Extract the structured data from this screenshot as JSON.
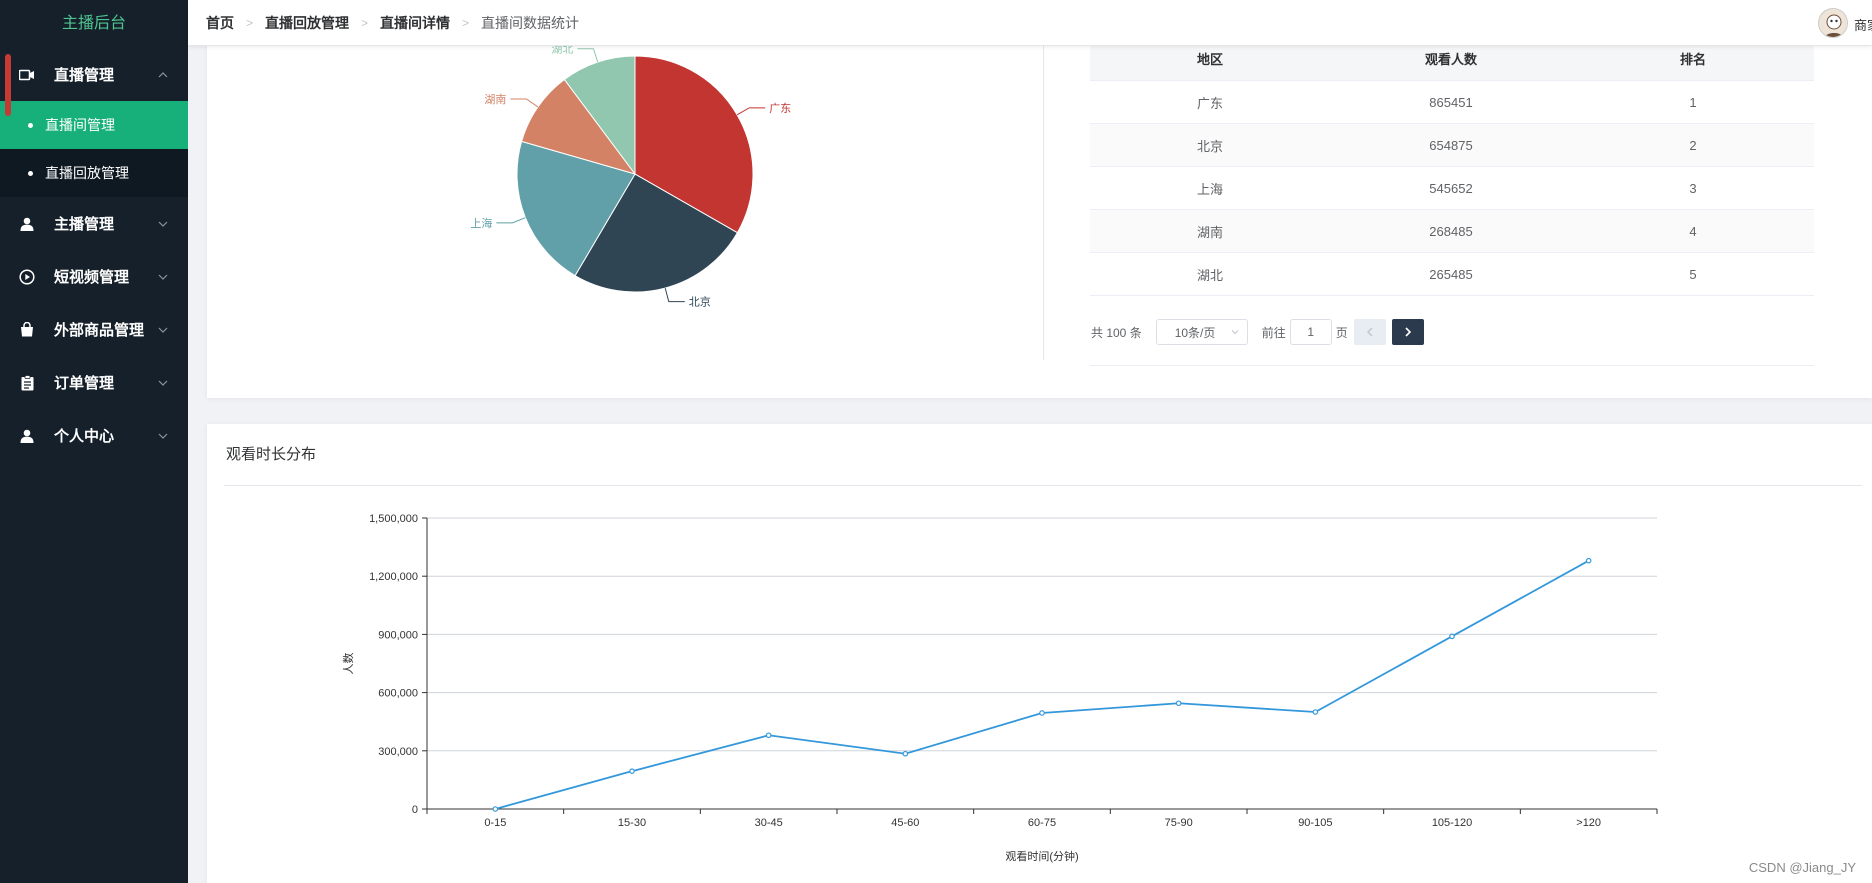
{
  "sidebar": {
    "brand": "主播后台",
    "menu": [
      {
        "label": "直播管理",
        "icon": "video-camera-icon",
        "expanded": true,
        "children": [
          {
            "label": "直播间管理",
            "active": true
          },
          {
            "label": "直播回放管理",
            "active": false
          }
        ]
      },
      {
        "label": "主播管理",
        "icon": "user-icon"
      },
      {
        "label": "短视频管理",
        "icon": "play-circle-icon"
      },
      {
        "label": "外部商品管理",
        "icon": "shopping-bag-icon"
      },
      {
        "label": "订单管理",
        "icon": "clipboard-icon"
      },
      {
        "label": "个人中心",
        "icon": "person-icon"
      }
    ]
  },
  "header": {
    "breadcrumb": [
      "首页",
      "直播回放管理",
      "直播间详情",
      "直播间数据统计"
    ],
    "user_name": "商家"
  },
  "region_table": {
    "columns": [
      "地区",
      "观看人数",
      "排名"
    ],
    "rows": [
      [
        "广东",
        "865451",
        "1"
      ],
      [
        "北京",
        "654875",
        "2"
      ],
      [
        "上海",
        "545652",
        "3"
      ],
      [
        "湖南",
        "268485",
        "4"
      ],
      [
        "湖北",
        "265485",
        "5"
      ]
    ]
  },
  "pagination": {
    "total": "共 100 条",
    "page_size": "10条/页",
    "goto_label": "前往",
    "page_value": "1",
    "page_suffix": "页"
  },
  "duration_card": {
    "title": "观看时长分布"
  },
  "watermark": "CSDN @Jiang_JY",
  "chart_data": [
    {
      "type": "pie",
      "labels": [
        "广东",
        "北京",
        "上海",
        "湖南",
        "湖北"
      ],
      "values": [
        865451,
        654875,
        545652,
        268485,
        265485
      ],
      "colors": [
        "#c23531",
        "#2f4554",
        "#61a0a8",
        "#d48265",
        "#91c7ae"
      ]
    },
    {
      "type": "line",
      "categories": [
        "0-15",
        "15-30",
        "30-45",
        "45-60",
        "60-75",
        "75-90",
        "90-105",
        "105-120",
        ">120"
      ],
      "series": [
        {
          "values": [
            0,
            195000,
            380000,
            285000,
            495000,
            545000,
            500000,
            890000,
            1280000
          ]
        }
      ],
      "xlabel": "观看时间(分钟)",
      "ylabel": "人数",
      "yticks": [
        "0",
        "300,000",
        "600,000",
        "900,000",
        "1,200,000",
        "1,500,000"
      ],
      "ylim": [
        0,
        1500000
      ],
      "color": "#3398db",
      "grid": true
    }
  ]
}
